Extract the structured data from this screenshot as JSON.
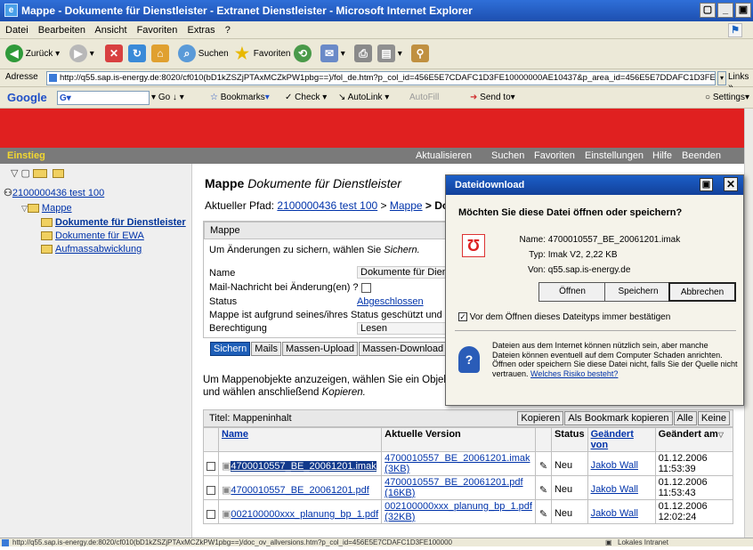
{
  "window": {
    "title": "Mappe - Dokumente für Dienstleister - Extranet Dienstleister - Microsoft Internet Explorer"
  },
  "menu": [
    "Datei",
    "Bearbeiten",
    "Ansicht",
    "Favoriten",
    "Extras",
    "?"
  ],
  "toolbar": {
    "back": "Zurück",
    "search": "Suchen",
    "favorites": "Favoriten"
  },
  "address": {
    "label": "Adresse",
    "url": "http://q55.sap.is-energy.de:8020/cf010(bD1kZSZjPTAxMCZkPW1pbg==)/fol_de.htm?p_col_id=456E5E7CDAFC1D3FE10000000AE10437&p_area_id=456E5E7DDAFC1D3FE10000(",
    "links": "Links"
  },
  "googlebar": {
    "brand": "Google",
    "go": "Go",
    "bookmarks": "Bookmarks",
    "check": "Check",
    "autolink": "AutoLink",
    "autofill": "AutoFill",
    "sendto": "Send to",
    "settings": "Settings"
  },
  "portal": {
    "left": "Einstieg",
    "nav": [
      "Aktualisieren",
      "Suchen",
      "Favoriten",
      "Einstellungen",
      "Hilfe",
      "Beenden"
    ]
  },
  "tree": {
    "root": "2100000436 test 100",
    "folder": "Mappe",
    "children": [
      "Dokumente für Dienstleister",
      "Dokumente für EWA",
      "Aufmassabwicklung"
    ]
  },
  "main": {
    "heading_prefix": "Mappe",
    "heading_italic": "Dokumente für Dienstleister",
    "path_label": "Aktueller Pfad:",
    "path_root": "2100000436 test 100",
    "path_sep": " > ",
    "path_folder": "Mappe",
    "path_current": " > Dokum",
    "panel_title": "Mappe",
    "save_hint": "Um Änderungen zu sichern, wählen Sie",
    "save_hint_em": "Sichern.",
    "fields": {
      "name_label": "Name",
      "name_value": "Dokumente für Diens",
      "mail_label": "Mail-Nachricht bei Änderung(en) ?",
      "status_label": "Status",
      "status_value": "Abgeschlossen",
      "locked_text": "Mappe ist aufgrund seines/ihres Status geschützt und l",
      "perm_label": "Berechtigung",
      "perm_value": "Lesen"
    },
    "buttons": [
      "Sichern",
      "Mails",
      "Massen-Upload",
      "Massen-Download",
      "A"
    ],
    "info1": "Um Mappenobjekte anzuzeigen, wählen Sie ein Objekt. U",
    "info2": "und wählen anschließend",
    "info2_em": "Kopieren."
  },
  "contents": {
    "title": "Titel: Mappeninhalt",
    "actions": [
      "Kopieren",
      "Als Bookmark kopieren",
      "Alle",
      "Keine"
    ],
    "headers": [
      "Name",
      "Aktuelle Version",
      "Status",
      "Geändert von",
      "Geändert am"
    ],
    "rows": [
      {
        "name": "4700010557_BE_20061201.imak",
        "version": "4700010557_BE_20061201.imak",
        "size": "(3KB)",
        "status": "Neu",
        "user": "Jakob Wall",
        "date": "01.12.2006",
        "time": "11:53:39"
      },
      {
        "name": "4700010557_BE_20061201.pdf",
        "version": "4700010557_BE_20061201.pdf",
        "size": "(16KB)",
        "status": "Neu",
        "user": "Jakob Wall",
        "date": "01.12.2006",
        "time": "11:53:43"
      },
      {
        "name": "002100000xxx_planung_bp_1.pdf",
        "version": "002100000xxx_planung_bp_1.pdf",
        "size": "(32KB)",
        "status": "Neu",
        "user": "Jakob Wall",
        "date": "01.12.2006",
        "time": "12:02:24"
      }
    ]
  },
  "dialog": {
    "title": "Dateidownload",
    "question": "Möchten Sie diese Datei öffnen oder speichern?",
    "name_label": "Name:",
    "name_value": "4700010557_BE_20061201.imak",
    "type_label": "Typ:",
    "type_value": "Imak V2, 2,22 KB",
    "from_label": "Von:",
    "from_value": "q55.sap.is-energy.de",
    "btn_open": "Öffnen",
    "btn_save": "Speichern",
    "btn_cancel": "Abbrechen",
    "checkbox": "Vor dem Öffnen dieses Dateityps immer bestätigen",
    "warning": "Dateien aus dem Internet können nützlich sein, aber manche Dateien können eventuell auf dem Computer Schaden anrichten. Öffnen oder speichern Sie diese Datei nicht, falls Sie der Quelle nicht vertrauen.",
    "risk_link": "Welches Risiko besteht?"
  },
  "statusbar": {
    "url": "http://q55.sap.is-energy.de:8020/cf010(bD1kZSZjPTAxMCZkPW1pbg==)/doc_ov_allversions.htm?p_col_id=456E5E7CDAFC1D3FE100000",
    "zone": "Lokales Intranet"
  }
}
